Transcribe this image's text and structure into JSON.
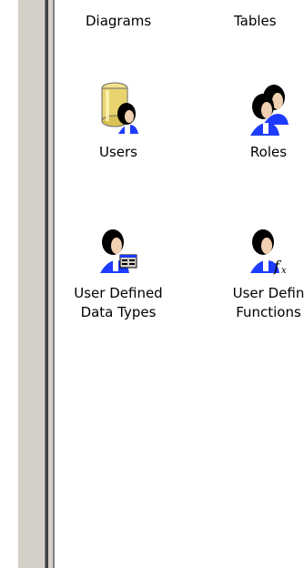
{
  "items": [
    {
      "label": "Diagrams",
      "icon": "diagram-icon"
    },
    {
      "label": "Tables",
      "icon": "table-icon"
    },
    {
      "label": "Users",
      "icon": "users-database-icon"
    },
    {
      "label": "Roles",
      "icon": "roles-icon"
    },
    {
      "label": "User Defined\nData Types",
      "icon": "user-defined-data-types-icon"
    },
    {
      "label": "User Defin\nFunctions",
      "icon": "user-defined-functions-icon"
    }
  ],
  "colors": {
    "face_dark": "#000000",
    "skin": "#f0d0b0",
    "body_blue": "#1e3cff",
    "cylinder_yellow": "#f2e28a",
    "window_gray": "#d4d0c8"
  }
}
